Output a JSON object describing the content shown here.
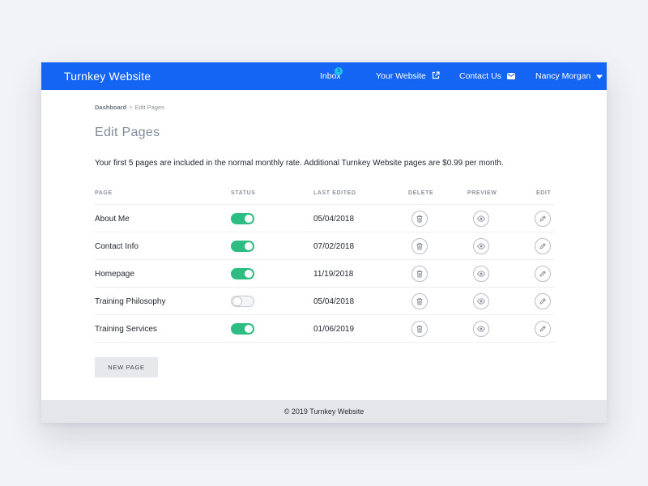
{
  "nav": {
    "brand": "Turnkey Website",
    "inbox_label": "Inbox",
    "inbox_badge": "3",
    "website_label": "Your Website",
    "contact_label": "Contact Us",
    "user_name": "Nancy Morgan",
    "accent_color": "#1565f5",
    "icons": {
      "website": "external-link-icon",
      "contact": "envelope-icon",
      "user": "caret-down-icon"
    }
  },
  "breadcrumb": {
    "home": "Dashboard",
    "separator": ">",
    "current": "Edit Pages"
  },
  "page_title": "Edit Pages",
  "intro_text": "Your first 5 pages are included in the normal monthly rate. Additional Turnkey Website pages are $0.99 per month.",
  "table": {
    "headers": {
      "page": "PAGE",
      "status": "STATUS",
      "last_edited": "LAST EDITED",
      "delete": "DELETE",
      "preview": "PREVIEW",
      "edit": "EDIT"
    },
    "rows": [
      {
        "name": "About Me",
        "status_on": true,
        "last_edited": "05/04/2018"
      },
      {
        "name": "Contact Info",
        "status_on": true,
        "last_edited": "07/02/2018"
      },
      {
        "name": "Homepage",
        "status_on": true,
        "last_edited": "11/19/2018"
      },
      {
        "name": "Training Philosophy",
        "status_on": false,
        "last_edited": "05/04/2018"
      },
      {
        "name": "Training Services",
        "status_on": true,
        "last_edited": "01/06/2019"
      }
    ],
    "toggle_on_color": "#2dbd83",
    "row_icons": {
      "delete": "trash-icon",
      "preview": "eye-icon",
      "edit": "pencil-icon"
    }
  },
  "new_page_label": "NEW PAGE",
  "footer_text": "© 2019 Turnkey Website"
}
